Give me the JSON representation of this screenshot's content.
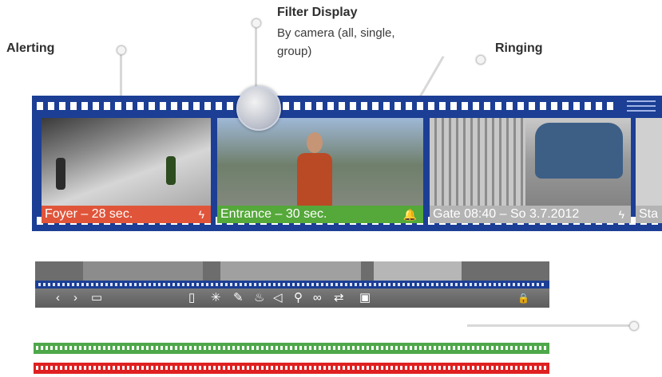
{
  "callouts": {
    "alerting": {
      "title": "Alerting"
    },
    "filter": {
      "title": "Filter Display",
      "line1": "By camera (all, single,",
      "line2": "group)"
    },
    "ringing": {
      "title": "Ringing"
    }
  },
  "film": {
    "frames": [
      {
        "label": "Foyer – 28 sec.",
        "icon_name": "activity-icon",
        "icon_glyph": "ϟ",
        "color": "#e0553a"
      },
      {
        "label": "Entrance – 30 sec.",
        "icon_name": "bell-icon",
        "icon_glyph": "🔔",
        "color": "#55a83a"
      },
      {
        "label": "Gate 08:40 – So 3.7.2012",
        "icon_name": "activity-icon",
        "icon_glyph": "ϟ",
        "color": "#b4b4b4"
      },
      {
        "label": "Sta",
        "color": "#b4b4b4"
      }
    ]
  },
  "player": {
    "prev": "‹",
    "next": "›",
    "layout": "▭",
    "icons": [
      {
        "name": "door-icon",
        "glyph": "▯"
      },
      {
        "name": "light-icon",
        "glyph": "✳"
      },
      {
        "name": "pin-icon",
        "glyph": "✎"
      },
      {
        "name": "thermometer-icon",
        "glyph": "♨"
      },
      {
        "name": "speaker-icon",
        "glyph": "◁"
      },
      {
        "name": "microphone-icon",
        "glyph": "⚲"
      },
      {
        "name": "link-icon",
        "glyph": "∞"
      },
      {
        "name": "swap-icon",
        "glyph": "⇄"
      },
      {
        "name": "snapshot-icon",
        "glyph": "▣"
      }
    ],
    "lock": "🔒"
  },
  "colors": {
    "film_blue": "#1c3f95",
    "alert_red": "#e02020",
    "ok_green": "#4ea84a"
  }
}
